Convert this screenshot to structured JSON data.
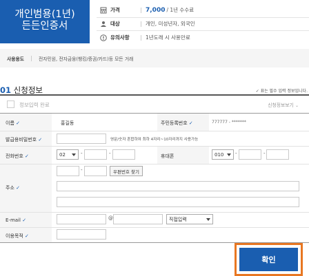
{
  "product": {
    "line1": "개인범용(1년)",
    "line2": "든든인증서"
  },
  "info": [
    {
      "icon": "won-icon",
      "key": "가격",
      "price": "7,000",
      "value": "/ 1년 수수료"
    },
    {
      "icon": "person-icon",
      "key": "대상",
      "value": "개인, 미성년자, 외국인"
    },
    {
      "icon": "warning-icon",
      "key": "유의사항",
      "value": "1년도래 시 사용만료"
    }
  ],
  "usage": {
    "key": "사용용도",
    "value": "전자민원, 전자금융(뱅킹/증권/카드)등 모든 거래"
  },
  "section": {
    "num": "01",
    "title": "신청정보",
    "required_note": "✓ 표는 필수 입력 정보입니다."
  },
  "form_head": {
    "checkbox_label": "정보입력 완료",
    "view_more": "신청정보보기"
  },
  "form": {
    "name_label": "이름",
    "name_value": "홍길동",
    "rrn_label": "주민등록번호",
    "rrn_value": "777777 - *******",
    "pw_label": "발급용비밀번호",
    "pw_hint": "영문/숫자 혼합하여 최하 4자리~10자리까지 사용가능",
    "phone_label": "전화번호",
    "phone_prefix": "02",
    "mobile_label": "휴대폰",
    "mobile_prefix": "010",
    "dash": "-",
    "address_label": "주소",
    "zip_button": "우편번호 찾기",
    "email_label": "E-mail",
    "at": "@",
    "email_select": "직접입력",
    "purpose_label": "이용목적",
    "check": "✓"
  },
  "confirm_label": "확인",
  "colors": {
    "brand": "#1a5eb0",
    "highlight": "#e87722"
  }
}
